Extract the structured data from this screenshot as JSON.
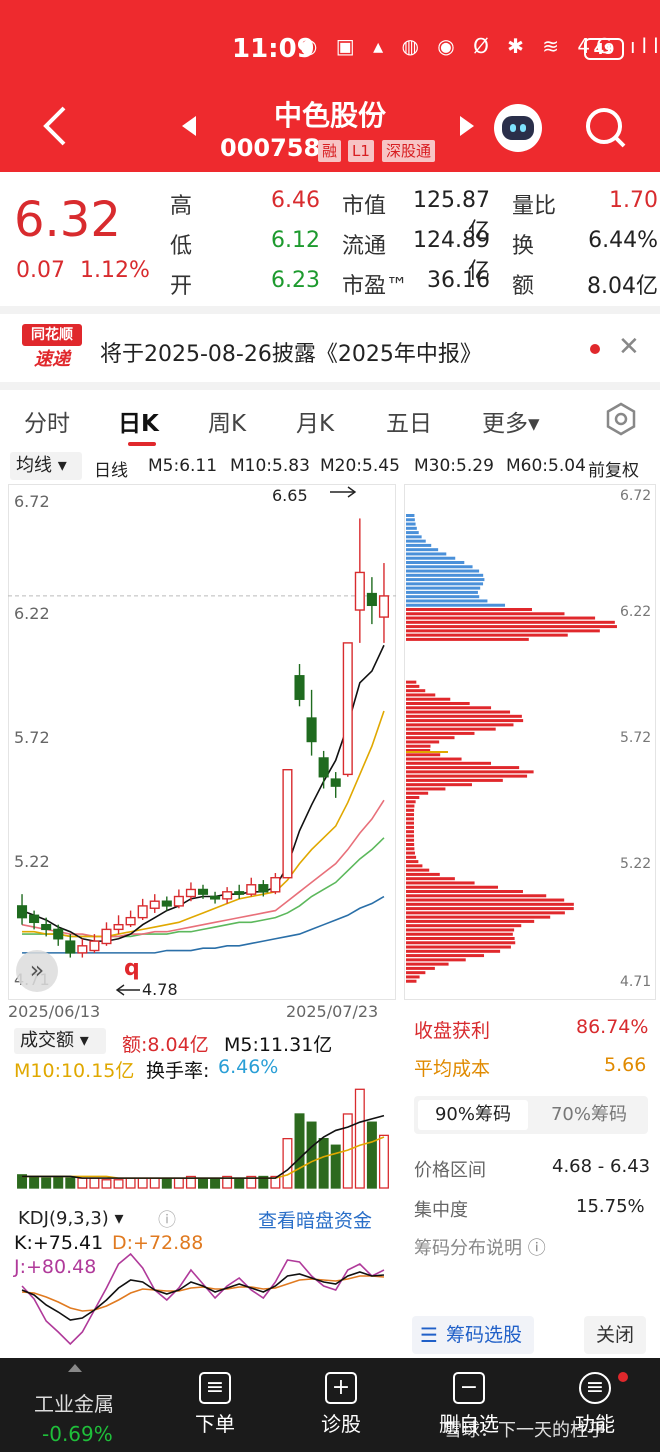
{
  "status_bar": {
    "time": "11:09",
    "icons": "◐ ▣ ▴ ◍ ◉ Ø ✱ ≋ 4G ıll",
    "battery": "49"
  },
  "header": {
    "title": "中色股份",
    "code": "000758",
    "tags": [
      "融",
      "L1",
      "深股通"
    ]
  },
  "quote": {
    "price": "6.32",
    "change": "0.07",
    "change_pct": "1.12%",
    "rows": [
      {
        "l1": "高",
        "v1": "6.46",
        "c1": "red",
        "l2": "市值",
        "v2": "125.87亿",
        "l3": "量比",
        "v3": "1.70",
        "c3": "red"
      },
      {
        "l1": "低",
        "v1": "6.12",
        "c1": "green",
        "l2": "流通",
        "v2": "124.89亿",
        "l3": "换",
        "v3": "6.44%",
        "c3": "dark"
      },
      {
        "l1": "开",
        "v1": "6.23",
        "c1": "green",
        "l2": "市盈™",
        "v2": "36.16",
        "l3": "额",
        "v3": "8.04亿",
        "c3": "dark"
      }
    ]
  },
  "news": {
    "logo_top": "同花顺",
    "logo_bottom": "速递",
    "text": "将于2025-08-26披露《2025年中报》"
  },
  "tabs": [
    "分时",
    "日K",
    "周K",
    "月K",
    "五日",
    "更多▾"
  ],
  "active_tab": "日K",
  "ma_bar": {
    "selector": "均线 ▾",
    "period": "日线",
    "items": [
      {
        "label": "M5:6.11",
        "color": "#111111"
      },
      {
        "label": "M10:5.83",
        "color": "#e0a800"
      },
      {
        "label": "M20:5.45",
        "color": "#e8707a"
      },
      {
        "label": "M30:5.29",
        "color": "#5cb85c"
      },
      {
        "label": "M60:5.04",
        "color": "#2a6fa8"
      }
    ],
    "adjust": "前复权"
  },
  "kline": {
    "y_labels": [
      "6.72",
      "6.22",
      "5.72",
      "5.22"
    ],
    "bottom_label": "4.71",
    "high_marker": "6.65",
    "low_marker": "4.78",
    "date_start": "2025/06/13",
    "date_end": "2025/07/23",
    "scroll_mark": "»",
    "q_mark": "q"
  },
  "chip_axis": {
    "labels": [
      "6.72",
      "6.22",
      "5.72",
      "5.22",
      "4.71"
    ]
  },
  "chart_data": {
    "type": "candlestick",
    "title": "",
    "y_range": [
      4.71,
      6.72
    ],
    "dates_span": [
      "2025/06/13",
      "2025/07/23"
    ],
    "candles": [
      {
        "o": 5.0,
        "c": 4.95,
        "h": 5.05,
        "l": 4.92
      },
      {
        "o": 4.96,
        "c": 4.93,
        "h": 4.98,
        "l": 4.9
      },
      {
        "o": 4.92,
        "c": 4.9,
        "h": 4.95,
        "l": 4.87
      },
      {
        "o": 4.9,
        "c": 4.86,
        "h": 4.92,
        "l": 4.83
      },
      {
        "o": 4.85,
        "c": 4.8,
        "h": 4.88,
        "l": 4.78
      },
      {
        "o": 4.8,
        "c": 4.83,
        "h": 4.86,
        "l": 4.78
      },
      {
        "o": 4.81,
        "c": 4.85,
        "h": 4.88,
        "l": 4.8
      },
      {
        "o": 4.84,
        "c": 4.9,
        "h": 4.93,
        "l": 4.83
      },
      {
        "o": 4.9,
        "c": 4.92,
        "h": 4.96,
        "l": 4.88
      },
      {
        "o": 4.92,
        "c": 4.95,
        "h": 4.98,
        "l": 4.91
      },
      {
        "o": 4.95,
        "c": 5.0,
        "h": 5.03,
        "l": 4.94
      },
      {
        "o": 4.99,
        "c": 5.02,
        "h": 5.05,
        "l": 4.97
      },
      {
        "o": 5.02,
        "c": 5.0,
        "h": 5.04,
        "l": 4.98
      },
      {
        "o": 5.0,
        "c": 5.04,
        "h": 5.07,
        "l": 4.99
      },
      {
        "o": 5.04,
        "c": 5.07,
        "h": 5.1,
        "l": 5.02
      },
      {
        "o": 5.07,
        "c": 5.05,
        "h": 5.09,
        "l": 5.03
      },
      {
        "o": 5.04,
        "c": 5.03,
        "h": 5.06,
        "l": 5.01
      },
      {
        "o": 5.03,
        "c": 5.06,
        "h": 5.08,
        "l": 5.01
      },
      {
        "o": 5.06,
        "c": 5.05,
        "h": 5.09,
        "l": 5.03
      },
      {
        "o": 5.05,
        "c": 5.09,
        "h": 5.12,
        "l": 5.04
      },
      {
        "o": 5.09,
        "c": 5.06,
        "h": 5.11,
        "l": 5.04
      },
      {
        "o": 5.06,
        "c": 5.12,
        "h": 5.14,
        "l": 5.05
      },
      {
        "o": 5.12,
        "c": 5.58,
        "h": 5.58,
        "l": 5.12
      },
      {
        "o": 5.98,
        "c": 5.88,
        "h": 6.03,
        "l": 5.85
      },
      {
        "o": 5.8,
        "c": 5.7,
        "h": 5.92,
        "l": 5.64
      },
      {
        "o": 5.63,
        "c": 5.55,
        "h": 5.66,
        "l": 5.5
      },
      {
        "o": 5.54,
        "c": 5.51,
        "h": 5.57,
        "l": 5.46
      },
      {
        "o": 5.56,
        "c": 6.12,
        "h": 6.12,
        "l": 5.55
      },
      {
        "o": 6.26,
        "c": 6.42,
        "h": 6.65,
        "l": 6.12
      },
      {
        "o": 6.33,
        "c": 6.28,
        "h": 6.4,
        "l": 6.2
      },
      {
        "o": 6.23,
        "c": 6.32,
        "h": 6.46,
        "l": 6.12
      }
    ],
    "ma": {
      "M5": [
        4.98,
        4.96,
        4.94,
        4.91,
        4.89,
        4.86,
        4.85,
        4.85,
        4.86,
        4.88,
        4.92,
        4.95,
        4.98,
        5.0,
        5.03,
        5.04,
        5.04,
        5.05,
        5.05,
        5.06,
        5.06,
        5.08,
        5.17,
        5.32,
        5.43,
        5.53,
        5.62,
        5.77,
        5.95,
        6.0,
        6.11
      ],
      "M10": [
        4.89,
        4.89,
        4.88,
        4.88,
        4.87,
        4.87,
        4.87,
        4.87,
        4.88,
        4.89,
        4.9,
        4.91,
        4.92,
        4.93,
        4.95,
        4.97,
        4.99,
        5.01,
        5.03,
        5.04,
        5.05,
        5.06,
        5.11,
        5.18,
        5.24,
        5.29,
        5.34,
        5.44,
        5.56,
        5.68,
        5.83
      ],
      "M20": [
        4.92,
        4.91,
        4.9,
        4.89,
        4.88,
        4.88,
        4.87,
        4.87,
        4.87,
        4.88,
        4.88,
        4.89,
        4.89,
        4.9,
        4.91,
        4.92,
        4.93,
        4.94,
        4.95,
        4.96,
        4.97,
        4.98,
        5.02,
        5.06,
        5.1,
        5.14,
        5.18,
        5.24,
        5.31,
        5.37,
        5.45
      ],
      "M30": [
        4.88,
        4.88,
        4.88,
        4.88,
        4.87,
        4.87,
        4.87,
        4.87,
        4.87,
        4.87,
        4.88,
        4.88,
        4.88,
        4.89,
        4.89,
        4.9,
        4.91,
        4.92,
        4.93,
        4.93,
        4.94,
        4.95,
        4.97,
        5.0,
        5.04,
        5.07,
        5.1,
        5.15,
        5.2,
        5.24,
        5.29
      ],
      "M60": [
        4.8,
        4.8,
        4.8,
        4.8,
        4.8,
        4.8,
        4.8,
        4.8,
        4.8,
        4.8,
        4.8,
        4.8,
        4.81,
        4.81,
        4.81,
        4.82,
        4.82,
        4.83,
        4.83,
        4.84,
        4.85,
        4.86,
        4.87,
        4.88,
        4.9,
        4.92,
        4.94,
        4.96,
        4.99,
        5.01,
        5.04
      ]
    },
    "volume": [
      8,
      7,
      6,
      7,
      6,
      6,
      6,
      5,
      5,
      6,
      6,
      6,
      6,
      6,
      7,
      6,
      6,
      7,
      6,
      7,
      7,
      7,
      30,
      45,
      40,
      30,
      26,
      45,
      60,
      40,
      32
    ],
    "vol_ma5": [
      7,
      7,
      7,
      7,
      7,
      6,
      6,
      6,
      6,
      6,
      6,
      6,
      6,
      6,
      6,
      6,
      6,
      6,
      6,
      6,
      6,
      6,
      11,
      18,
      25,
      31,
      35,
      37,
      40,
      42,
      44
    ],
    "vol_ma10": [
      7,
      7,
      7,
      7,
      7,
      7,
      7,
      7,
      6,
      6,
      6,
      6,
      6,
      6,
      6,
      6,
      6,
      6,
      6,
      6,
      6,
      6,
      8,
      12,
      16,
      19,
      21,
      23,
      26,
      28,
      31
    ],
    "kdj": {
      "K": [
        60,
        55,
        45,
        38,
        30,
        32,
        40,
        50,
        62,
        70,
        68,
        60,
        56,
        60,
        68,
        64,
        58,
        62,
        66,
        62,
        58,
        64,
        74,
        76,
        72,
        68,
        66,
        74,
        78,
        74,
        75
      ],
      "D": [
        58,
        57,
        53,
        48,
        42,
        39,
        40,
        44,
        50,
        57,
        61,
        60,
        59,
        59,
        62,
        63,
        61,
        61,
        63,
        63,
        61,
        62,
        66,
        70,
        71,
        70,
        69,
        71,
        74,
        74,
        73
      ],
      "J": [
        64,
        51,
        29,
        18,
        6,
        18,
        40,
        62,
        86,
        96,
        82,
        60,
        50,
        62,
        80,
        66,
        52,
        64,
        72,
        60,
        52,
        68,
        90,
        88,
        74,
        64,
        60,
        80,
        86,
        74,
        80
      ]
    },
    "chip_distribution": {
      "price_levels_from_top": "6.72 to 4.71",
      "profit_ratio_split": 6.32
    }
  },
  "vol_panel": {
    "title": "成交额 ▾",
    "amount": "额:8.04亿",
    "m5": "M5:11.31亿",
    "m10": "M10:10.15亿",
    "turnover_label": "换手率:",
    "turnover": "6.46%"
  },
  "kdj_panel": {
    "title": "KDJ(9,3,3) ▾",
    "k": "K:+75.41",
    "d": "D:+72.88",
    "j": "J:+80.48",
    "link": "查看暗盘资金"
  },
  "chip_panel": {
    "profit_label": "收盘获利",
    "profit_value": "86.74%",
    "cost_label": "平均成本",
    "cost_value": "5.66",
    "chip_on": "90%筹码",
    "chip_off": "70%筹码",
    "range_label": "价格区间",
    "range_value": "4.68 - 6.43",
    "conc_label": "集中度",
    "conc_value": "15.75%",
    "explain": "筹码分布说明 ⓘ",
    "select_button": "筹码选股",
    "close_button": "关闭"
  },
  "bottom_bar": {
    "sector": "工业金属",
    "sector_change": "-0.69%",
    "items": [
      "下单",
      "诊股",
      "删自选",
      "功能"
    ]
  },
  "watermark": "雪球：下一天的柱乎"
}
